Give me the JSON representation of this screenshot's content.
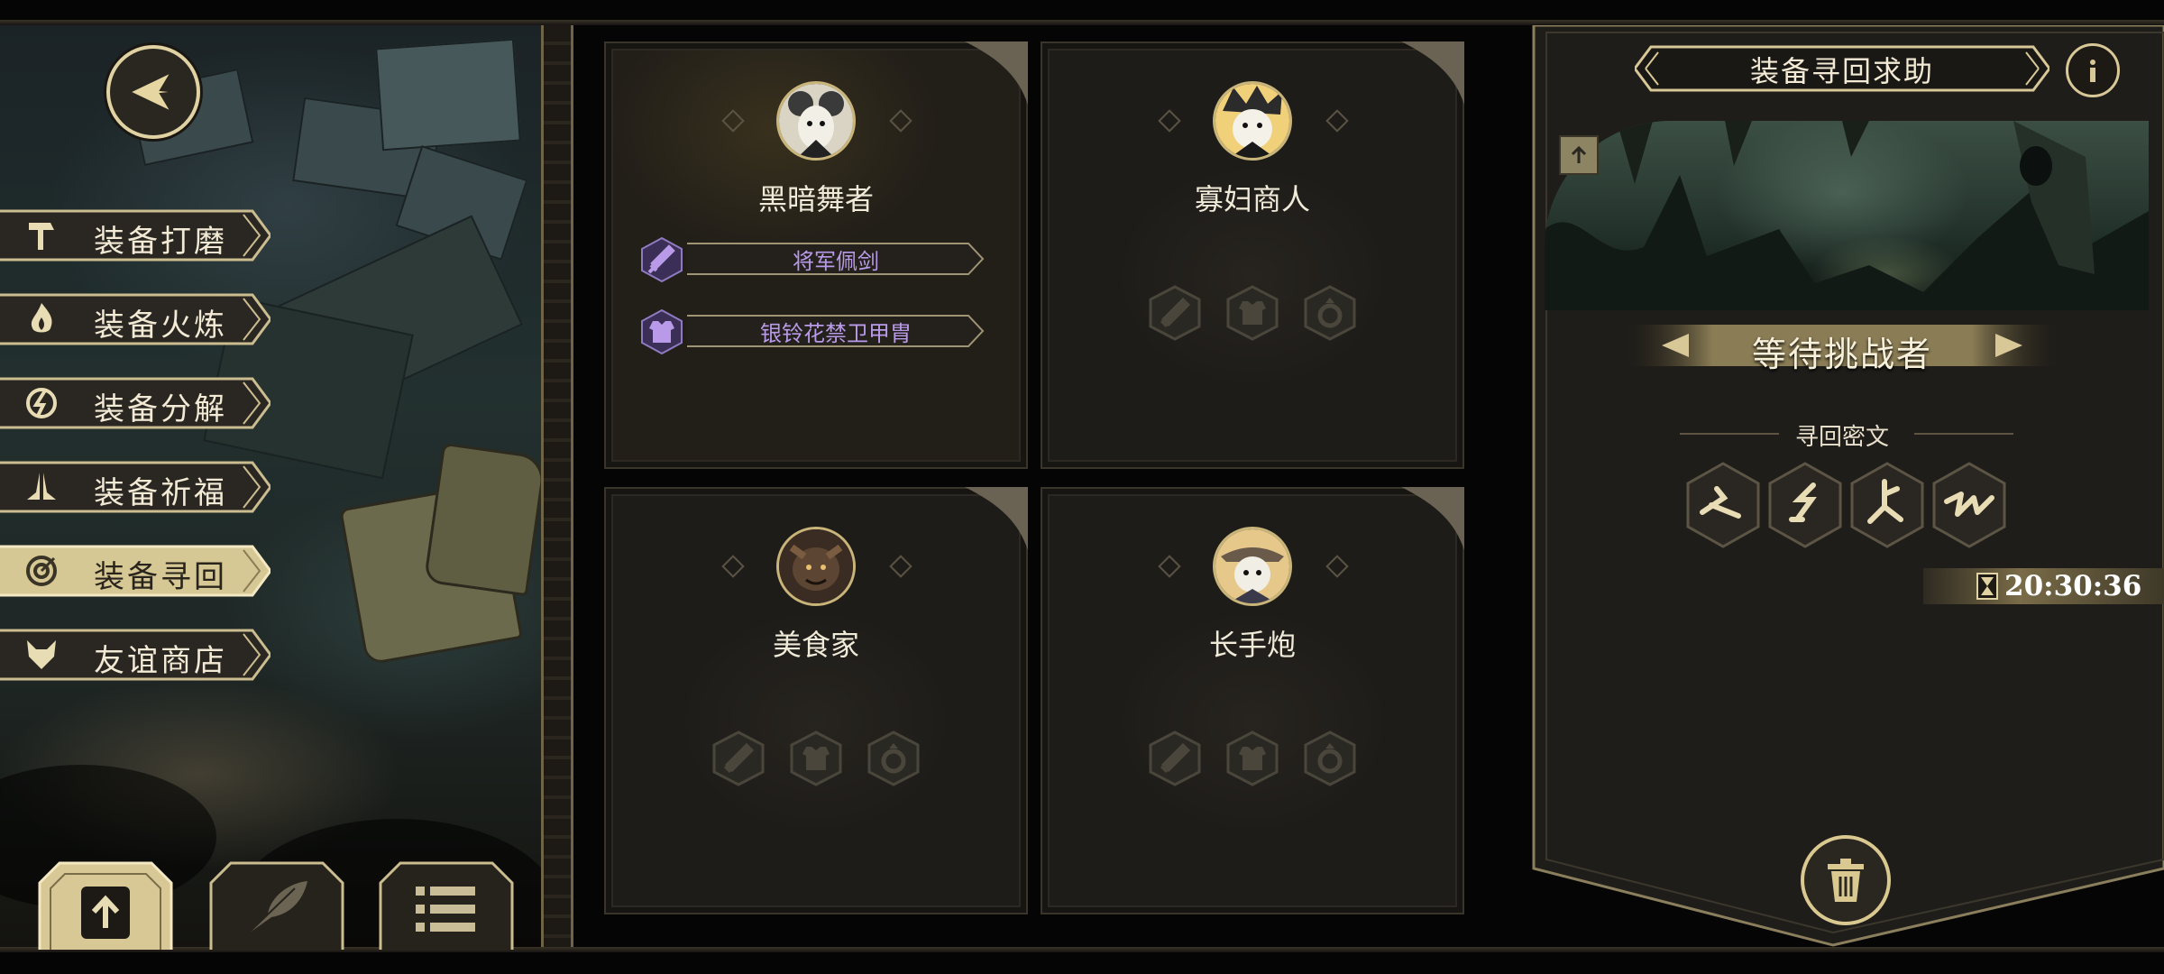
{
  "left_menu": {
    "items": [
      {
        "label": "装备打磨",
        "icon": "hammer-icon"
      },
      {
        "label": "装备火炼",
        "icon": "flame-icon"
      },
      {
        "label": "装备分解",
        "icon": "dismantle-icon"
      },
      {
        "label": "装备祈福",
        "icon": "pray-icon"
      },
      {
        "label": "装备寻回",
        "icon": "target-icon",
        "active": true
      },
      {
        "label": "友谊商店",
        "icon": "fox-icon"
      }
    ],
    "bottom_tabs": [
      "upload-icon",
      "feather-icon",
      "list-icon"
    ]
  },
  "cards": [
    {
      "name": "黑暗舞者",
      "avatar": "mouse-dancer-avatar",
      "items": [
        {
          "label": "将军佩剑",
          "icon": "sword-icon"
        },
        {
          "label": "银铃花禁卫甲胄",
          "icon": "armor-icon"
        }
      ]
    },
    {
      "name": "寡妇商人",
      "avatar": "widow-merchant-avatar",
      "slots": [
        "sword-slot-icon",
        "armor-slot-icon",
        "ring-slot-icon"
      ]
    },
    {
      "name": "美食家",
      "avatar": "gourmet-avatar",
      "slots": [
        "sword-slot-icon",
        "armor-slot-icon",
        "ring-slot-icon"
      ]
    },
    {
      "name": "长手炮",
      "avatar": "long-arm-cannon-avatar",
      "slots": [
        "sword-slot-icon",
        "armor-slot-icon",
        "ring-slot-icon"
      ]
    }
  ],
  "right_panel": {
    "title": "装备寻回求助",
    "status": "等待挑战者",
    "cipher_label": "寻回密文",
    "runes": [
      "rune-1-icon",
      "rune-2-icon",
      "rune-3-icon",
      "rune-4-icon"
    ],
    "timer": "20:30:36"
  },
  "colors": {
    "gold": "#d8c898",
    "purple_item": "#b99ae8",
    "panel_bg": "#1e1c19"
  }
}
